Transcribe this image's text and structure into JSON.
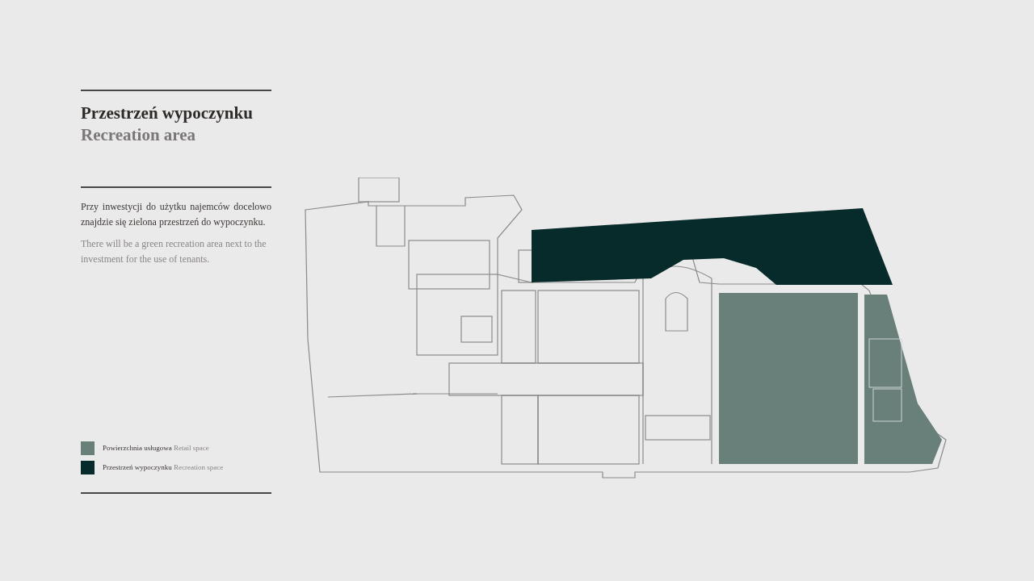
{
  "heading": {
    "title": "Przestrzeń wypoczynku",
    "subtitle": "Recreation area"
  },
  "description": {
    "polish": "Przy inwestycji do użytku najemców docelowo znajdzie się zielona przestrzeń do wypoczynku.",
    "english": "There will be a green recreation area next to the investment for the use of tenants."
  },
  "legend": [
    {
      "label": "Powierzchnia usługowa",
      "translation": "Retail space",
      "color": "#687f7a"
    },
    {
      "label": "Przestrzeń wypoczynku",
      "translation": "Recreation space",
      "color": "#062b2a"
    }
  ]
}
